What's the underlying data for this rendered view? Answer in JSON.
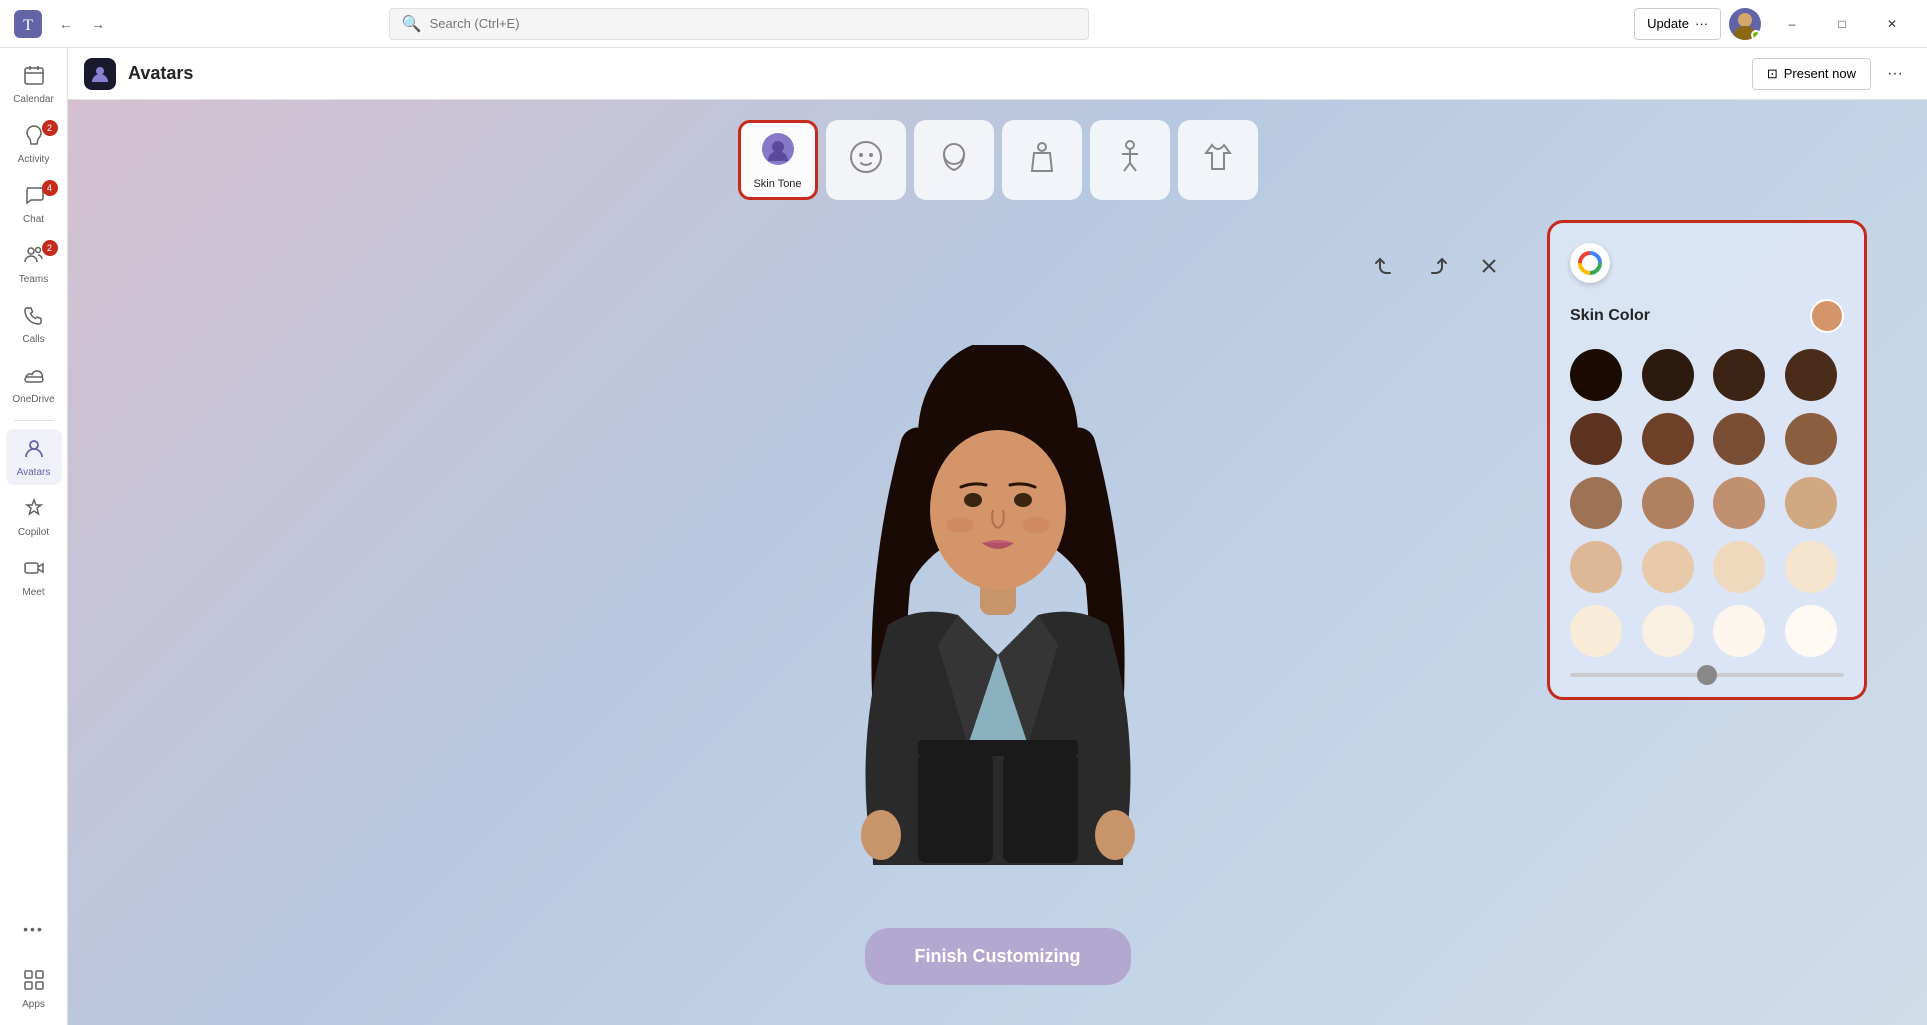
{
  "titleBar": {
    "searchPlaceholder": "Search (Ctrl+E)",
    "updateLabel": "Update",
    "moreLabel": "···",
    "minimize": "–",
    "maximize": "□",
    "close": "✕"
  },
  "sidebar": {
    "items": [
      {
        "id": "calendar",
        "label": "Calendar",
        "icon": "📅",
        "badge": null,
        "active": false
      },
      {
        "id": "activity",
        "label": "Activity",
        "icon": "🔔",
        "badge": "2",
        "active": false
      },
      {
        "id": "chat",
        "label": "Chat",
        "icon": "💬",
        "badge": "4",
        "active": false
      },
      {
        "id": "teams",
        "label": "Teams",
        "icon": "👥",
        "badge": "2",
        "active": false
      },
      {
        "id": "calls",
        "label": "Calls",
        "icon": "📞",
        "badge": null,
        "active": false
      },
      {
        "id": "onedrive",
        "label": "OneDrive",
        "icon": "☁",
        "badge": null,
        "active": false
      },
      {
        "id": "avatars",
        "label": "Avatars",
        "icon": "🧑",
        "badge": null,
        "active": true
      },
      {
        "id": "copilot",
        "label": "Copilot",
        "icon": "⬡",
        "badge": null,
        "active": false
      },
      {
        "id": "meet",
        "label": "Meet",
        "icon": "📷",
        "badge": null,
        "active": false
      },
      {
        "id": "more",
        "label": "···",
        "icon": "···",
        "badge": null,
        "active": false
      },
      {
        "id": "apps",
        "label": "Apps",
        "icon": "⊞",
        "badge": null,
        "active": false
      }
    ]
  },
  "appHeader": {
    "title": "Avatars",
    "presentLabel": "Present now",
    "moreLabel": "···"
  },
  "customToolbar": {
    "tools": [
      {
        "id": "skin-tone",
        "label": "Skin Tone",
        "icon": "🎨",
        "active": true
      },
      {
        "id": "face",
        "label": "",
        "icon": "😊",
        "active": false
      },
      {
        "id": "head",
        "label": "",
        "icon": "🧑",
        "active": false
      },
      {
        "id": "body",
        "label": "",
        "icon": "👔",
        "active": false
      },
      {
        "id": "pose",
        "label": "",
        "icon": "🤸",
        "active": false
      },
      {
        "id": "outfit",
        "label": "",
        "icon": "👕",
        "active": false
      }
    ]
  },
  "skinPanel": {
    "title": "Skin Color",
    "colors": [
      "#1a0a00",
      "#2c1a0e",
      "#3d2314",
      "#4a2c1a",
      "#5c3320",
      "#6e4028",
      "#7a4e35",
      "#8b5e40",
      "#9e7355",
      "#b08060",
      "#c09070",
      "#d0a882",
      "#ddb896",
      "#e8c9aa",
      "#f0d8bc",
      "#f5e4ce",
      "#f8ecd8",
      "#faf0e2",
      "#fdf6ee",
      "#fff9f4"
    ],
    "selectedColor": "#d4956a",
    "sliderValue": 50
  },
  "actions": {
    "undo": "↩",
    "redo": "↪",
    "close": "✕"
  },
  "finishButton": {
    "label": "Finish Customizing"
  }
}
